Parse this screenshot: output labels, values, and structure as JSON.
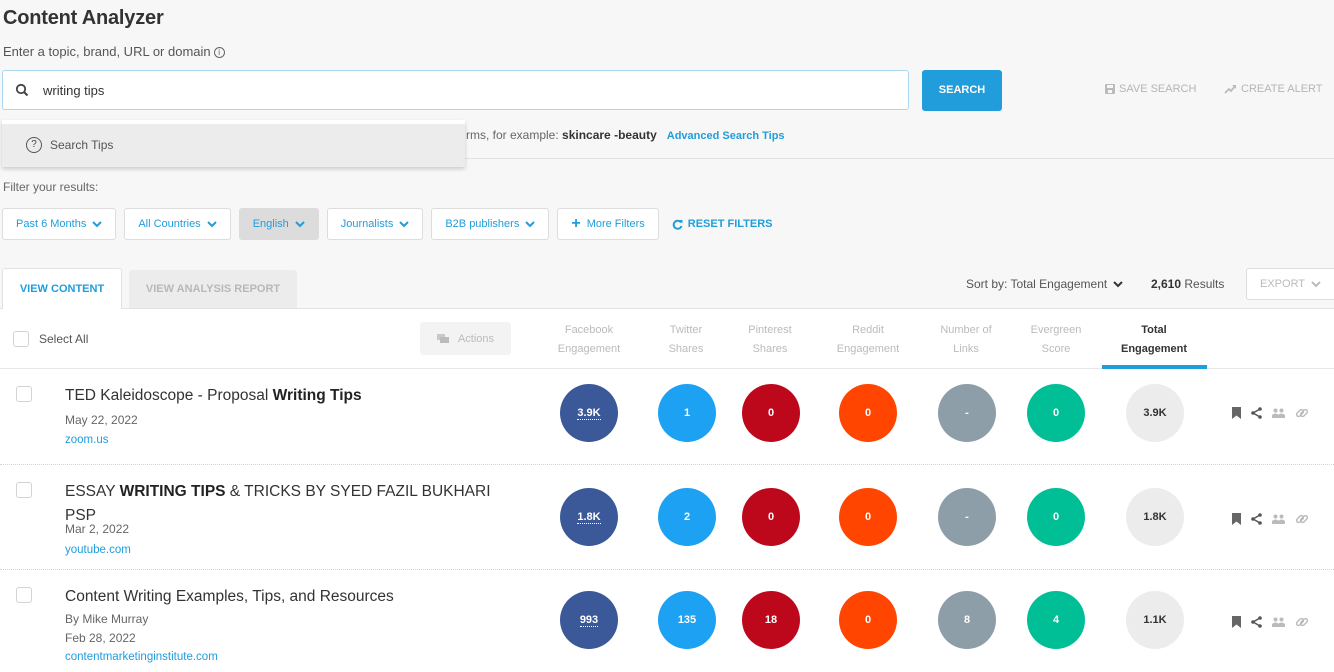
{
  "header": {
    "title": "Content Analyzer",
    "subtitle": "Enter a topic, brand, URL or domain",
    "info_icon": "i"
  },
  "search": {
    "value": "writing tips",
    "placeholder": "",
    "button_label": "SEARCH",
    "save_search_label": "SAVE SEARCH",
    "create_alert_label": "CREATE ALERT",
    "tip_prefix": "rms, for example: ",
    "tip_example": "skincare -beauty",
    "advanced_tips_link": "Advanced Search Tips",
    "dropdown": {
      "items": [
        {
          "label": "Search Tips",
          "icon": "question-circle-icon"
        }
      ]
    }
  },
  "filters": {
    "label": "Filter your results:",
    "chips": [
      {
        "label": "Past 6 Months",
        "active": false
      },
      {
        "label": "All Countries",
        "active": false
      },
      {
        "label": "English",
        "active": true
      },
      {
        "label": "Journalists",
        "active": false
      },
      {
        "label": "B2B publishers",
        "active": false
      }
    ],
    "more_filters_label": "More Filters",
    "reset_label": "RESET FILTERS"
  },
  "tabs": [
    {
      "label": "VIEW CONTENT",
      "active": true
    },
    {
      "label": "VIEW ANALYSIS REPORT",
      "active": false
    }
  ],
  "results_bar": {
    "sort_label": "Sort by: Total Engagement",
    "results_count": "2,610",
    "results_suffix": "Results",
    "export_label": "EXPORT"
  },
  "table": {
    "select_all_label": "Select All",
    "actions_label": "Actions",
    "columns": [
      {
        "line1": "Facebook",
        "line2": "Engagement",
        "color": "#3b5998"
      },
      {
        "line1": "Twitter",
        "line2": "Shares",
        "color": "#1da1f2"
      },
      {
        "line1": "Pinterest",
        "line2": "Shares",
        "color": "#bd081c"
      },
      {
        "line1": "Reddit",
        "line2": "Engagement",
        "color": "#ff4500"
      },
      {
        "line1": "Number of",
        "line2": "Links",
        "color": "#8d9ea8"
      },
      {
        "line1": "Evergreen",
        "line2": "Score",
        "color": "#00bf96"
      },
      {
        "line1": "Total",
        "line2": "Engagement",
        "color": "#ececec",
        "active": true
      }
    ],
    "rows": [
      {
        "title_plain": "TED Kaleidoscope - Proposal ",
        "title_bold": "Writing Tips",
        "title_after": "",
        "author": "",
        "date": "May 22, 2022",
        "domain": "zoom.us",
        "metrics": [
          "3.9K",
          "1",
          "0",
          "0",
          "-",
          "0",
          "3.9K"
        ]
      },
      {
        "title_plain": "ESSAY ",
        "title_bold": "WRITING TIPS",
        "title_after": " & TRICKS BY SYED FAZIL BUKHARI PSP",
        "author": "",
        "date": "Mar 2, 2022",
        "domain": "youtube.com",
        "metrics": [
          "1.8K",
          "2",
          "0",
          "0",
          "-",
          "0",
          "1.8K"
        ]
      },
      {
        "title_plain": "Content Writing Examples, Tips, and Resources",
        "title_bold": "",
        "title_after": "",
        "author": "By  Mike Murray",
        "date": "Feb 28, 2022",
        "domain": "contentmarketinginstitute.com",
        "metrics": [
          "993",
          "135",
          "18",
          "0",
          "8",
          "4",
          "1.1K"
        ]
      }
    ],
    "row_action_icons": [
      "bookmark-icon",
      "share-icon",
      "users-icon",
      "link-icon"
    ]
  },
  "colors": {
    "accent": "#219ddb"
  }
}
